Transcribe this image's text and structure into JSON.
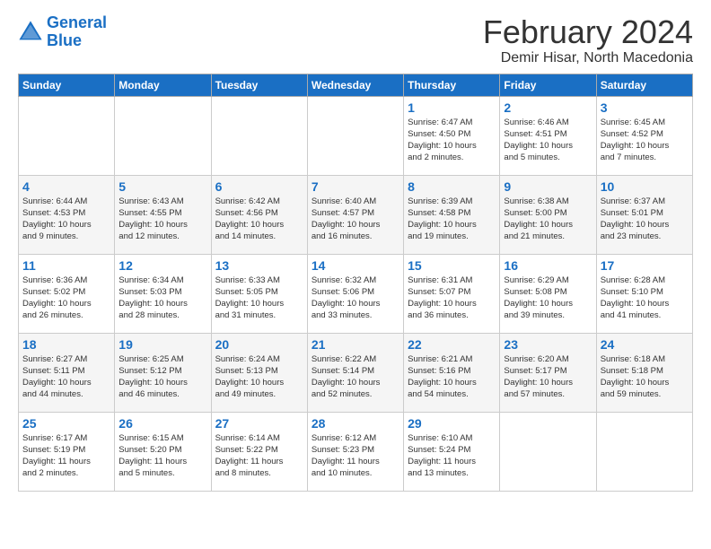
{
  "header": {
    "logo_line1": "General",
    "logo_line2": "Blue",
    "title": "February 2024",
    "subtitle": "Demir Hisar, North Macedonia"
  },
  "weekdays": [
    "Sunday",
    "Monday",
    "Tuesday",
    "Wednesday",
    "Thursday",
    "Friday",
    "Saturday"
  ],
  "weeks": [
    [
      {
        "day": "",
        "info": ""
      },
      {
        "day": "",
        "info": ""
      },
      {
        "day": "",
        "info": ""
      },
      {
        "day": "",
        "info": ""
      },
      {
        "day": "1",
        "info": "Sunrise: 6:47 AM\nSunset: 4:50 PM\nDaylight: 10 hours\nand 2 minutes."
      },
      {
        "day": "2",
        "info": "Sunrise: 6:46 AM\nSunset: 4:51 PM\nDaylight: 10 hours\nand 5 minutes."
      },
      {
        "day": "3",
        "info": "Sunrise: 6:45 AM\nSunset: 4:52 PM\nDaylight: 10 hours\nand 7 minutes."
      }
    ],
    [
      {
        "day": "4",
        "info": "Sunrise: 6:44 AM\nSunset: 4:53 PM\nDaylight: 10 hours\nand 9 minutes."
      },
      {
        "day": "5",
        "info": "Sunrise: 6:43 AM\nSunset: 4:55 PM\nDaylight: 10 hours\nand 12 minutes."
      },
      {
        "day": "6",
        "info": "Sunrise: 6:42 AM\nSunset: 4:56 PM\nDaylight: 10 hours\nand 14 minutes."
      },
      {
        "day": "7",
        "info": "Sunrise: 6:40 AM\nSunset: 4:57 PM\nDaylight: 10 hours\nand 16 minutes."
      },
      {
        "day": "8",
        "info": "Sunrise: 6:39 AM\nSunset: 4:58 PM\nDaylight: 10 hours\nand 19 minutes."
      },
      {
        "day": "9",
        "info": "Sunrise: 6:38 AM\nSunset: 5:00 PM\nDaylight: 10 hours\nand 21 minutes."
      },
      {
        "day": "10",
        "info": "Sunrise: 6:37 AM\nSunset: 5:01 PM\nDaylight: 10 hours\nand 23 minutes."
      }
    ],
    [
      {
        "day": "11",
        "info": "Sunrise: 6:36 AM\nSunset: 5:02 PM\nDaylight: 10 hours\nand 26 minutes."
      },
      {
        "day": "12",
        "info": "Sunrise: 6:34 AM\nSunset: 5:03 PM\nDaylight: 10 hours\nand 28 minutes."
      },
      {
        "day": "13",
        "info": "Sunrise: 6:33 AM\nSunset: 5:05 PM\nDaylight: 10 hours\nand 31 minutes."
      },
      {
        "day": "14",
        "info": "Sunrise: 6:32 AM\nSunset: 5:06 PM\nDaylight: 10 hours\nand 33 minutes."
      },
      {
        "day": "15",
        "info": "Sunrise: 6:31 AM\nSunset: 5:07 PM\nDaylight: 10 hours\nand 36 minutes."
      },
      {
        "day": "16",
        "info": "Sunrise: 6:29 AM\nSunset: 5:08 PM\nDaylight: 10 hours\nand 39 minutes."
      },
      {
        "day": "17",
        "info": "Sunrise: 6:28 AM\nSunset: 5:10 PM\nDaylight: 10 hours\nand 41 minutes."
      }
    ],
    [
      {
        "day": "18",
        "info": "Sunrise: 6:27 AM\nSunset: 5:11 PM\nDaylight: 10 hours\nand 44 minutes."
      },
      {
        "day": "19",
        "info": "Sunrise: 6:25 AM\nSunset: 5:12 PM\nDaylight: 10 hours\nand 46 minutes."
      },
      {
        "day": "20",
        "info": "Sunrise: 6:24 AM\nSunset: 5:13 PM\nDaylight: 10 hours\nand 49 minutes."
      },
      {
        "day": "21",
        "info": "Sunrise: 6:22 AM\nSunset: 5:14 PM\nDaylight: 10 hours\nand 52 minutes."
      },
      {
        "day": "22",
        "info": "Sunrise: 6:21 AM\nSunset: 5:16 PM\nDaylight: 10 hours\nand 54 minutes."
      },
      {
        "day": "23",
        "info": "Sunrise: 6:20 AM\nSunset: 5:17 PM\nDaylight: 10 hours\nand 57 minutes."
      },
      {
        "day": "24",
        "info": "Sunrise: 6:18 AM\nSunset: 5:18 PM\nDaylight: 10 hours\nand 59 minutes."
      }
    ],
    [
      {
        "day": "25",
        "info": "Sunrise: 6:17 AM\nSunset: 5:19 PM\nDaylight: 11 hours\nand 2 minutes."
      },
      {
        "day": "26",
        "info": "Sunrise: 6:15 AM\nSunset: 5:20 PM\nDaylight: 11 hours\nand 5 minutes."
      },
      {
        "day": "27",
        "info": "Sunrise: 6:14 AM\nSunset: 5:22 PM\nDaylight: 11 hours\nand 8 minutes."
      },
      {
        "day": "28",
        "info": "Sunrise: 6:12 AM\nSunset: 5:23 PM\nDaylight: 11 hours\nand 10 minutes."
      },
      {
        "day": "29",
        "info": "Sunrise: 6:10 AM\nSunset: 5:24 PM\nDaylight: 11 hours\nand 13 minutes."
      },
      {
        "day": "",
        "info": ""
      },
      {
        "day": "",
        "info": ""
      }
    ]
  ]
}
